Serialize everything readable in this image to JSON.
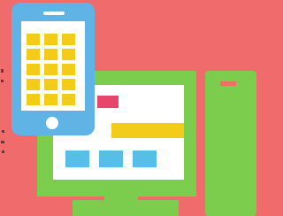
{
  "colors": {
    "background": "#f06b6c",
    "monitor_green": "#7ccc4e",
    "screen_white": "#ffffff",
    "phone_blue": "#5fb3e5",
    "phone_yellow": "#f3cb19",
    "block_red": "#e7456b",
    "block_yellow": "#f3cb19",
    "block_cyan": "#57bee8",
    "speckle_dark": "#3b2b2b"
  },
  "icons": {
    "phone": "smartphone-icon",
    "monitor": "desktop-monitor-icon",
    "tower": "computer-tower-icon"
  },
  "phone_grid": {
    "rows": 5,
    "cols": 3
  }
}
